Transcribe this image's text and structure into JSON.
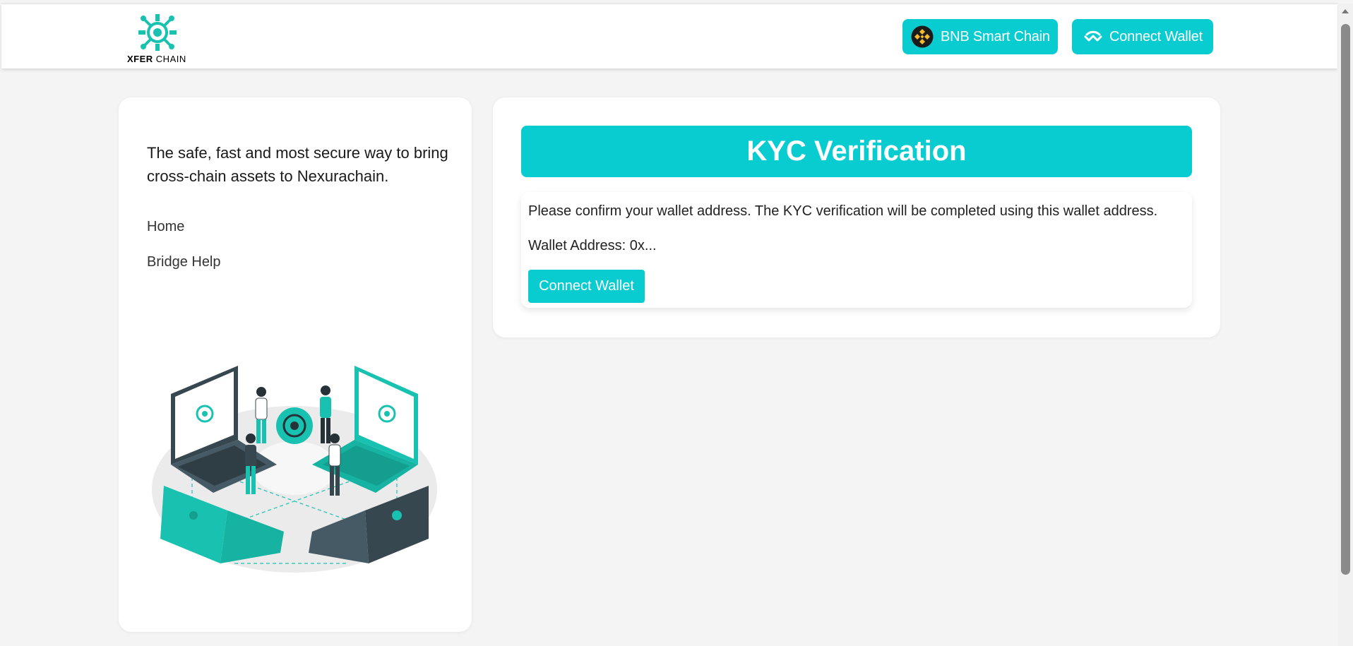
{
  "header": {
    "logo": {
      "brand_bold": "XFER",
      "brand_light": "CHAIN",
      "icon": "xfer-chain-logo-icon"
    },
    "network_button": {
      "label": "BNB Smart Chain",
      "icon": "bnb-icon"
    },
    "connect_button": {
      "label": "Connect Wallet",
      "icon": "walletconnect-icon"
    }
  },
  "sidebar": {
    "tagline": "The safe, fast and most secure way to bring cross-chain assets to Nexurachain.",
    "nav": [
      {
        "label": "Home"
      },
      {
        "label": "Bridge Help"
      }
    ],
    "illustration": "people-connecting-laptops-illustration"
  },
  "kyc": {
    "title": "KYC Verification",
    "message": "Please confirm your wallet address. The KYC verification will be completed using this wallet address.",
    "wallet_label": "Wallet Address:",
    "wallet_value": "0x...",
    "button_label": "Connect Wallet"
  },
  "colors": {
    "accent": "#08ccd0",
    "page_bg": "#f4f4f4",
    "card_bg": "#ffffff",
    "dark_teal": "#37474f"
  }
}
